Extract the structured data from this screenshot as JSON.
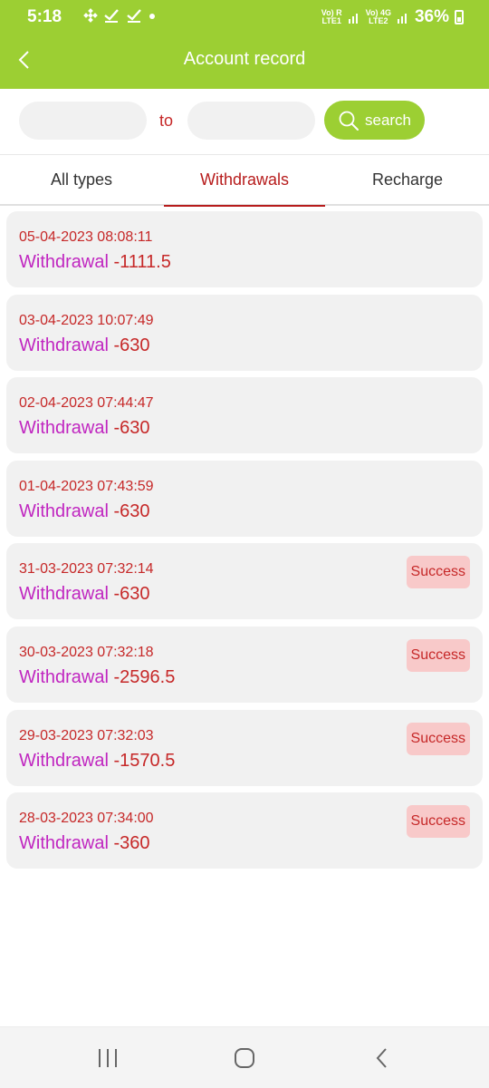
{
  "status_bar": {
    "time": "5:18",
    "net1": "Vo) R\nLTE1",
    "net2": "Vo) 4G\nLTE2",
    "battery": "36%"
  },
  "header": {
    "title": "Account record"
  },
  "search": {
    "to_label": "to",
    "from_value": "",
    "to_value": "",
    "button_label": "search"
  },
  "tabs": [
    {
      "label": "All types",
      "active": false
    },
    {
      "label": "Withdrawals",
      "active": true
    },
    {
      "label": "Recharge",
      "active": false
    }
  ],
  "records": [
    {
      "date": "05-04-2023 08:08:11",
      "type": "Withdrawal",
      "amount": "-1111.5",
      "status": ""
    },
    {
      "date": "03-04-2023 10:07:49",
      "type": "Withdrawal",
      "amount": "-630",
      "status": ""
    },
    {
      "date": "02-04-2023 07:44:47",
      "type": "Withdrawal",
      "amount": "-630",
      "status": ""
    },
    {
      "date": "01-04-2023 07:43:59",
      "type": "Withdrawal",
      "amount": "-630",
      "status": ""
    },
    {
      "date": "31-03-2023 07:32:14",
      "type": "Withdrawal",
      "amount": "-630",
      "status": "Success"
    },
    {
      "date": "30-03-2023 07:32:18",
      "type": "Withdrawal",
      "amount": "-2596.5",
      "status": "Success"
    },
    {
      "date": "29-03-2023 07:32:03",
      "type": "Withdrawal",
      "amount": "-1570.5",
      "status": "Success"
    },
    {
      "date": "28-03-2023 07:34:00",
      "type": "Withdrawal",
      "amount": "-360",
      "status": "Success"
    }
  ],
  "colors": {
    "accent": "#9ccf33",
    "amount": "#c62828",
    "type": "#c026c0",
    "status_bg": "#f8c9c9"
  }
}
